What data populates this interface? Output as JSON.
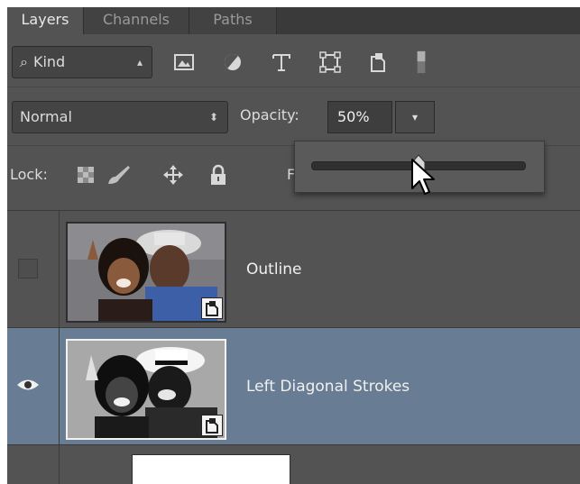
{
  "tabs": [
    {
      "label": "Layers",
      "active": true
    },
    {
      "label": "Channels",
      "active": false
    },
    {
      "label": "Paths",
      "active": false
    }
  ],
  "filter": {
    "kind_label": "Kind",
    "icons": [
      "image-filter-icon",
      "adjustment-filter-icon",
      "type-filter-icon",
      "shape-filter-icon",
      "smart-object-filter-icon",
      "filter-toggle-icon"
    ]
  },
  "blend": {
    "mode": "Normal",
    "opacity_label": "Opacity:",
    "opacity_value": "50%"
  },
  "lock": {
    "label": "Lock:",
    "fill_label_partial": "F"
  },
  "opacity_slider": {
    "value_fraction": 0.5
  },
  "layers": [
    {
      "name": "Outline",
      "visible": false,
      "selected": false,
      "smart_object": true
    },
    {
      "name": "Left Diagonal Strokes",
      "visible": true,
      "selected": true,
      "smart_object": true
    },
    {
      "name": "",
      "visible": false,
      "selected": false,
      "smart_object": false
    }
  ],
  "colors": {
    "panel_bg": "#535353",
    "selected_row": "#687c93",
    "tab_bar": "#3a3a3a"
  }
}
